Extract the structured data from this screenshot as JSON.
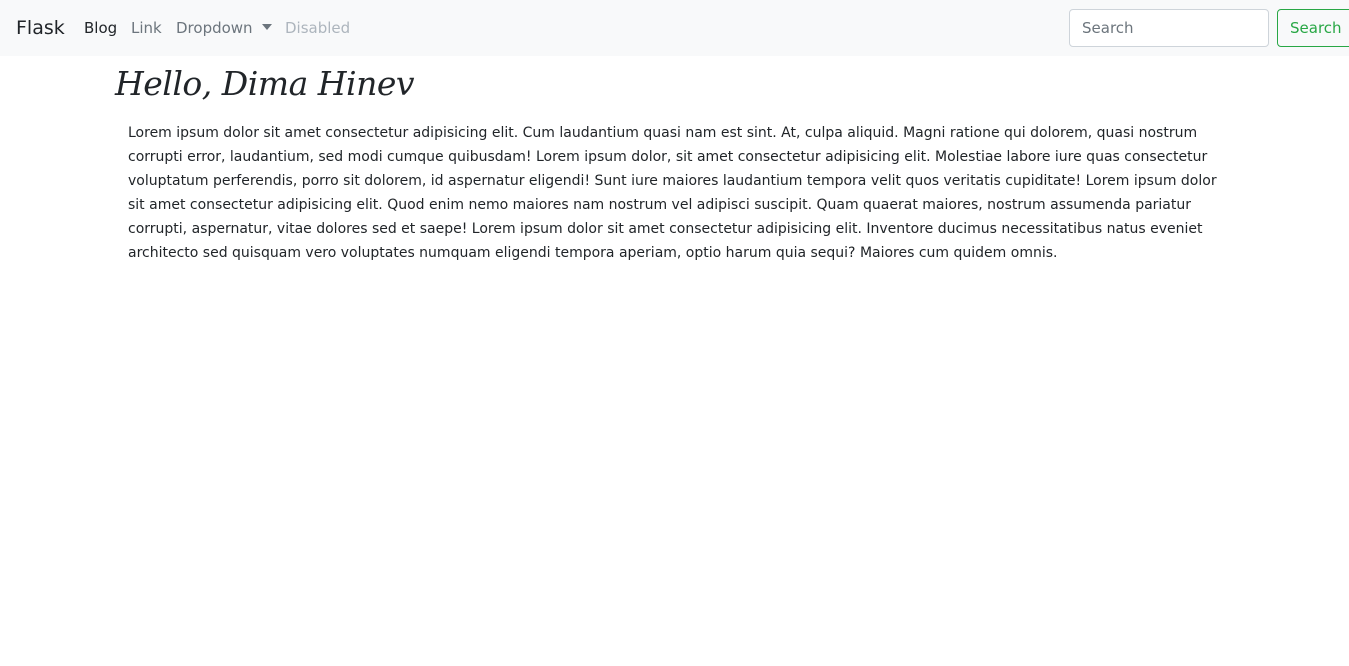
{
  "navbar": {
    "brand": "Flask",
    "links": [
      {
        "label": "Blog",
        "state": "active"
      },
      {
        "label": "Link",
        "state": "normal"
      },
      {
        "label": "Dropdown",
        "state": "normal",
        "icon": "caret-down-icon"
      },
      {
        "label": "Disabled",
        "state": "disabled"
      }
    ],
    "search": {
      "placeholder": "Search",
      "value": "",
      "button_label": "Search"
    }
  },
  "main": {
    "greeting": "Hello, Dima Hinev",
    "paragraph": "Lorem ipsum dolor sit amet consectetur adipisicing elit. Cum laudantium quasi nam est sint. At, culpa aliquid. Magni ratione qui dolorem, quasi nostrum corrupti error, laudantium, sed modi cumque quibusdam! Lorem ipsum dolor, sit amet consectetur adipisicing elit. Molestiae labore iure quas consectetur voluptatum perferendis, porro sit dolorem, id aspernatur eligendi! Sunt iure maiores laudantium tempora velit quos veritatis cupiditate! Lorem ipsum dolor sit amet consectetur adipisicing elit. Quod enim nemo maiores nam nostrum vel adipisci suscipit. Quam quaerat maiores, nostrum assumenda pariatur corrupti, aspernatur, vitae dolores sed et saepe! Lorem ipsum dolor sit amet consectetur adipisicing elit. Inventore ducimus necessitatibus natus eveniet architecto sed quisquam vero voluptates numquam eligendi tempora aperiam, optio harum quia sequi? Maiores cum quidem omnis."
  },
  "colors": {
    "navbar_bg": "#f8f9fa",
    "text": "#212529",
    "muted": "#6c757d",
    "disabled": "#adb5bd",
    "success": "#28a745"
  }
}
